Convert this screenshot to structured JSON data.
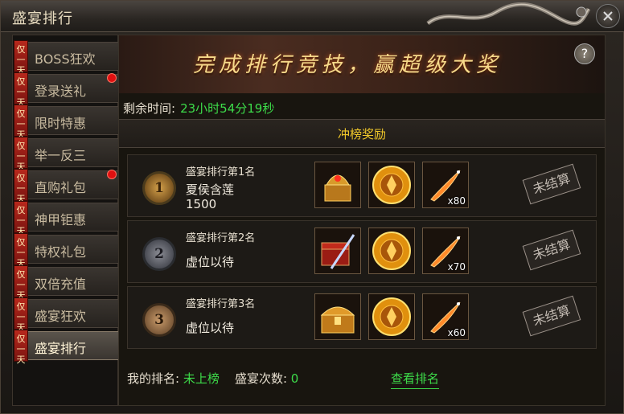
{
  "window": {
    "title": "盛宴排行"
  },
  "sidebar": {
    "items": [
      {
        "tag": "仅一天",
        "label": "BOSS狂欢",
        "dot": false,
        "active": false
      },
      {
        "tag": "仅一天",
        "label": "登录送礼",
        "dot": true,
        "active": false
      },
      {
        "tag": "仅一天",
        "label": "限时特惠",
        "dot": false,
        "active": false
      },
      {
        "tag": "仅一天",
        "label": "举一反三",
        "dot": false,
        "active": false
      },
      {
        "tag": "仅一天",
        "label": "直购礼包",
        "dot": true,
        "active": false
      },
      {
        "tag": "仅一天",
        "label": "神甲钜惠",
        "dot": false,
        "active": false
      },
      {
        "tag": "仅一天",
        "label": "特权礼包",
        "dot": false,
        "active": false
      },
      {
        "tag": "仅一天",
        "label": "双倍充值",
        "dot": false,
        "active": false
      },
      {
        "tag": "仅一天",
        "label": "盛宴狂欢",
        "dot": false,
        "active": false
      },
      {
        "tag": "仅一天",
        "label": "盛宴排行",
        "dot": false,
        "active": true
      }
    ]
  },
  "banner": {
    "text": "完成排行竞技，赢超级大奖",
    "help": "?"
  },
  "timer": {
    "label": "剩余时间:",
    "value": "23小时54分19秒"
  },
  "section": {
    "title": "冲榜奖励"
  },
  "ranks": [
    {
      "medal": "1",
      "title": "盛宴排行第1名",
      "name": "夏侯含莲",
      "value": "1500",
      "rewards": [
        {
          "icon": "golden-helmet-chest-icon",
          "count": ""
        },
        {
          "icon": "gold-coin-emblem-icon",
          "count": ""
        },
        {
          "icon": "fire-feather-icon",
          "count": "x80"
        }
      ],
      "status": "未结算"
    },
    {
      "medal": "2",
      "title": "盛宴排行第2名",
      "name": "虚位以待",
      "value": "",
      "rewards": [
        {
          "icon": "red-sword-chest-icon",
          "count": ""
        },
        {
          "icon": "gold-coin-emblem-icon",
          "count": ""
        },
        {
          "icon": "fire-feather-icon",
          "count": "x70"
        }
      ],
      "status": "未结算"
    },
    {
      "medal": "3",
      "title": "盛宴排行第3名",
      "name": "虚位以待",
      "value": "",
      "rewards": [
        {
          "icon": "golden-treasure-chest-icon",
          "count": ""
        },
        {
          "icon": "gold-coin-emblem-icon",
          "count": ""
        },
        {
          "icon": "fire-feather-icon",
          "count": "x60"
        }
      ],
      "status": "未结算"
    }
  ],
  "footer": {
    "my_rank_label": "我的排名:",
    "my_rank_value": "未上榜",
    "count_label": "盛宴次数:",
    "count_value": "0",
    "view_link": "查看排名"
  },
  "colors": {
    "accent_green": "#3ddc4a",
    "accent_gold": "#f0c82a",
    "tag_red": "#b8281c",
    "notify_red": "#e01010"
  }
}
